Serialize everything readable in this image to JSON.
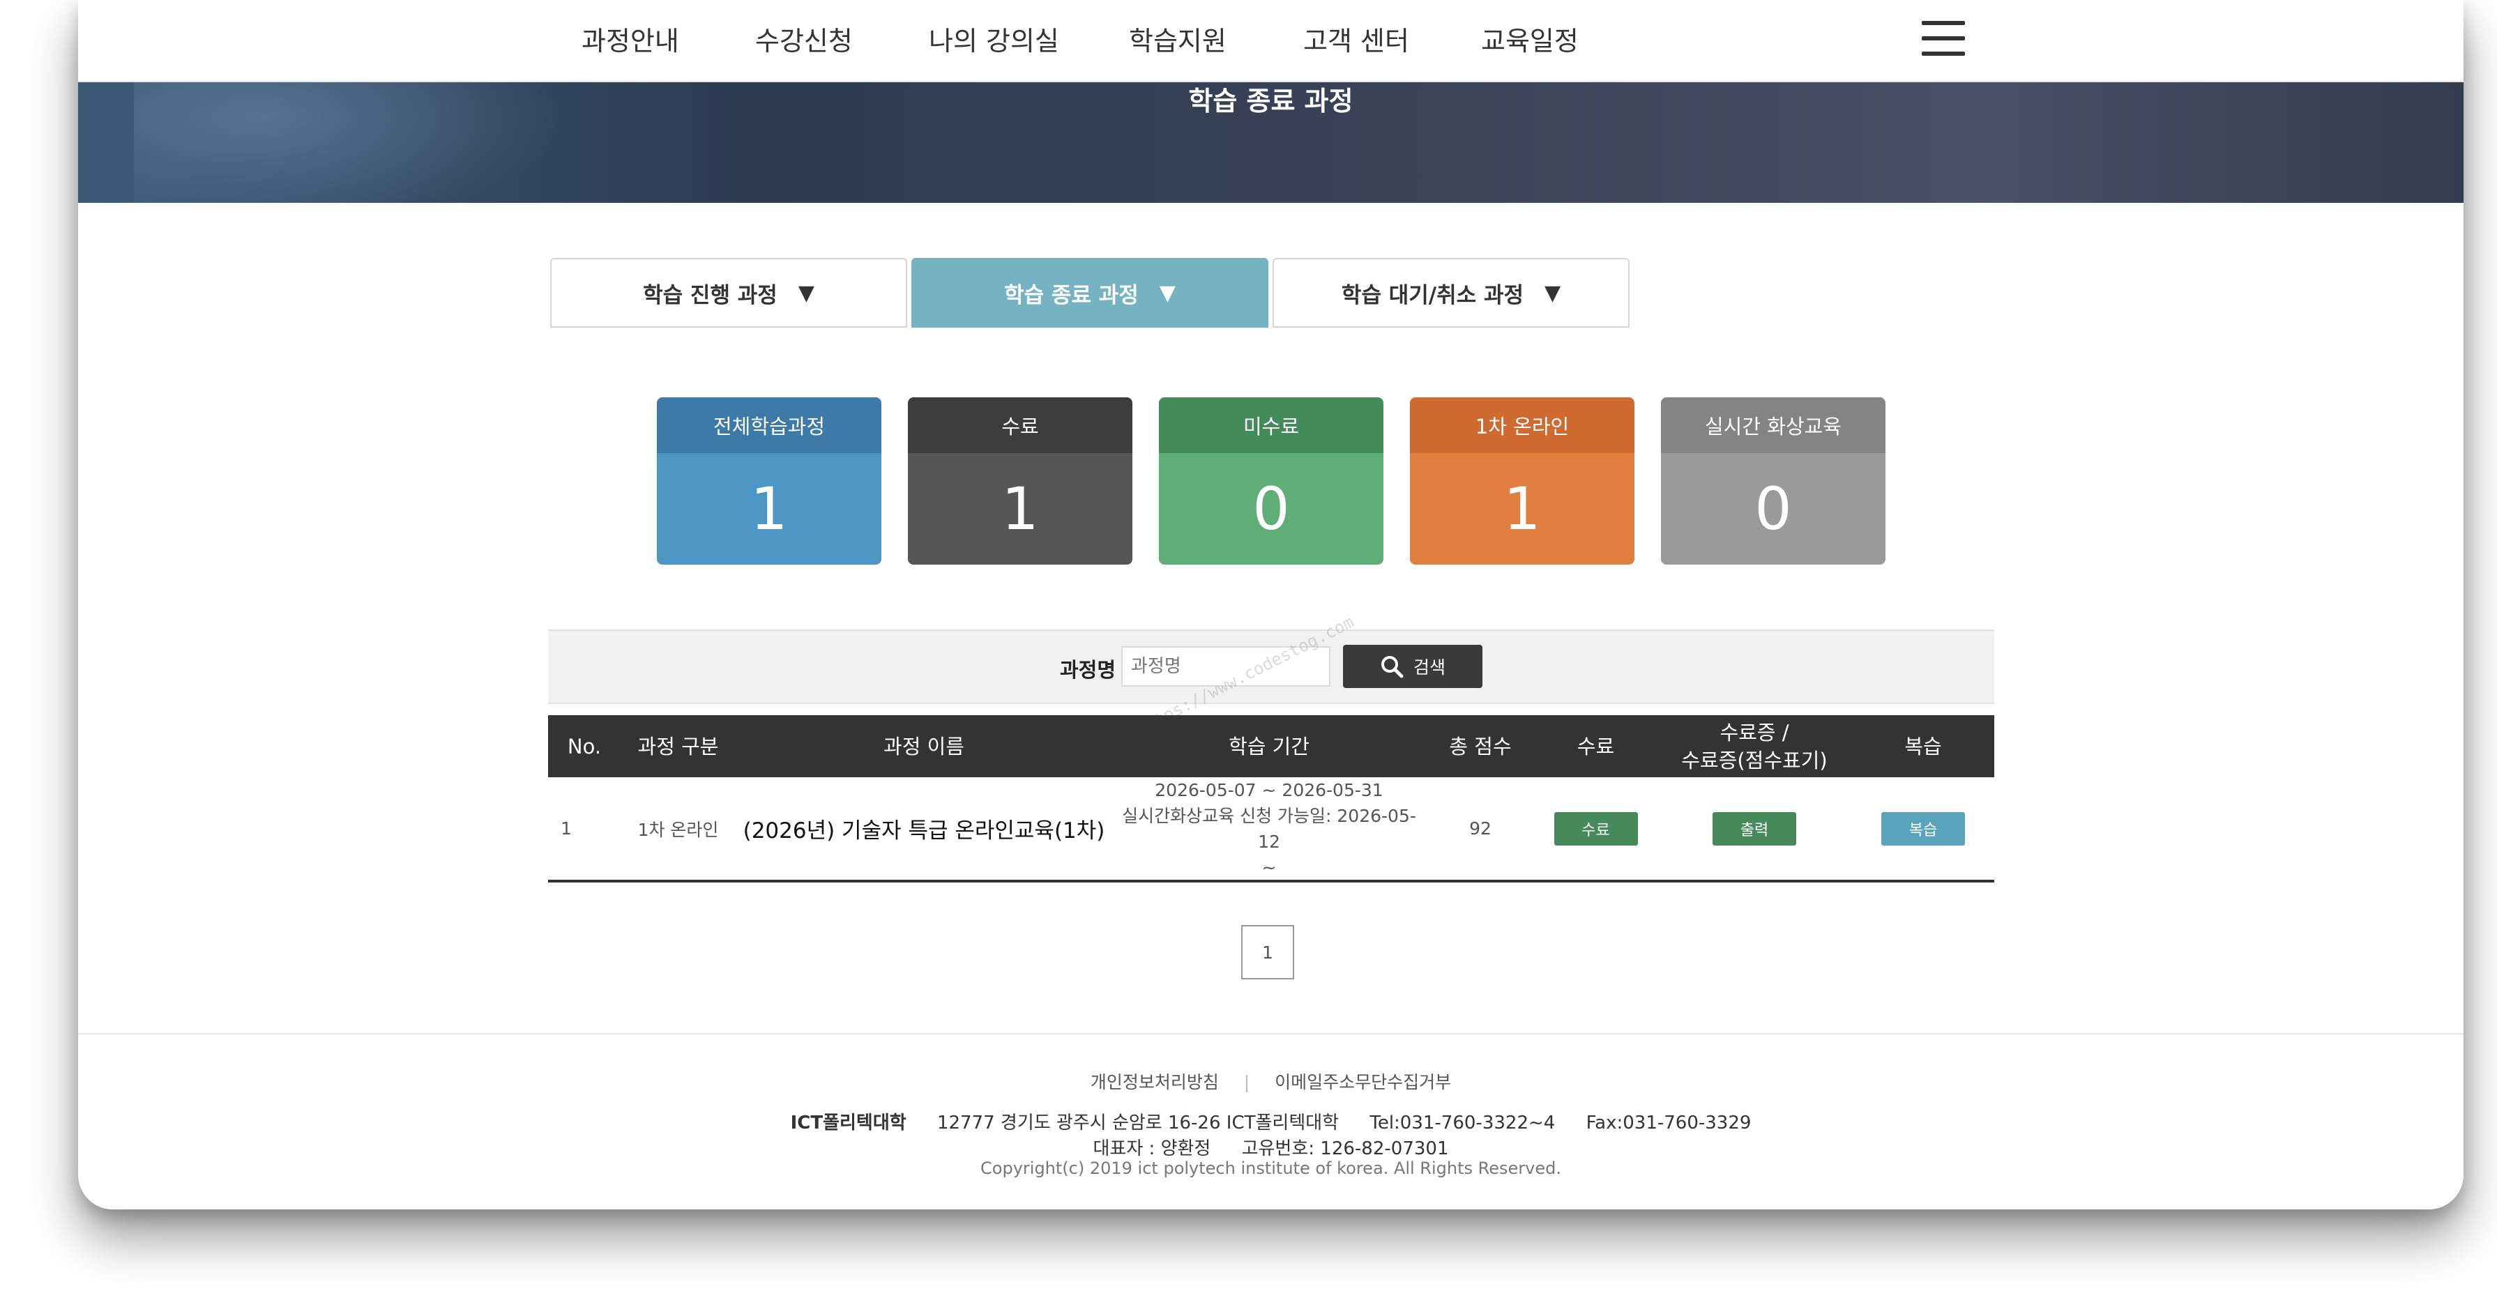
{
  "nav": {
    "items": [
      "과정안내",
      "수강신청",
      "나의 강의실",
      "학습지원",
      "고객 센터",
      "교육일정"
    ]
  },
  "hero": {
    "title": "학습 종료 과정"
  },
  "tabs": [
    {
      "label": "학습 진행 과정",
      "icon": "triangle-down-icon"
    },
    {
      "label": "학습 종료 과정",
      "icon": "triangle-down-icon"
    },
    {
      "label": "학습 대기/취소 과정",
      "icon": "triangle-down-icon"
    }
  ],
  "active_tab": "학습 종료 과정",
  "stats": [
    {
      "label": "전체학습과정",
      "value": "1",
      "head_color": "#3d7aa8",
      "body_color": "#4d96c4"
    },
    {
      "label": "수료",
      "value": "1",
      "head_color": "#3d3d3d",
      "body_color": "#565656"
    },
    {
      "label": "미수료",
      "value": "0",
      "head_color": "#438c5a",
      "body_color": "#5fae77"
    },
    {
      "label": "1차 온라인",
      "value": "1",
      "head_color": "#cf6a30",
      "body_color": "#e07f40"
    },
    {
      "label": "실시간 화상교육",
      "value": "0",
      "head_color": "#848484",
      "body_color": "#9a9a9a"
    }
  ],
  "search": {
    "label": "과정명",
    "placeholder": "과정명",
    "button_label": "검색",
    "button_icon": "search-icon"
  },
  "watermark": "https://www.codestog.com",
  "table": {
    "headers": [
      "No.",
      "과정 구분",
      "과정 이름",
      "학습 기간",
      "총 점수",
      "수료",
      "수료증 /\n수료증(점수표기)",
      "복습"
    ],
    "rows": [
      {
        "no": "1",
        "type": "1차 온라인",
        "name": "(2026년) 기술자 특급 온라인교육(1차)",
        "period": "2026-05-07 ~ 2026-05-31",
        "live_apply": "실시간화상교육 신청 가능일: 2026-05-12",
        "live_apply_end": "~",
        "score": "92",
        "status_label": "수료",
        "certificate_label": "출력",
        "review_label": "복습"
      }
    ]
  },
  "pagination": {
    "current": "1"
  },
  "footer": {
    "links": [
      "개인정보처리방침",
      "이메일주소무단수집거부"
    ],
    "org": "ICT폴리텍대학",
    "address": "12777 경기도 광주시 순암로 16-26 ICT폴리텍대학",
    "tel": "Tel:031-760-3322~4",
    "fax": "Fax:031-760-3329",
    "ceo": "대표자 : 양환정",
    "reg": "고유번호: 126-82-07301",
    "copyright": "Copyright(c) 2019 ict polytech institute of korea. All Rights Reserved."
  },
  "colors": {
    "tab_active": "#76b3c2",
    "table_header": "#333333",
    "status_green": "#468a5c",
    "review_blue": "#5aa3bd"
  }
}
